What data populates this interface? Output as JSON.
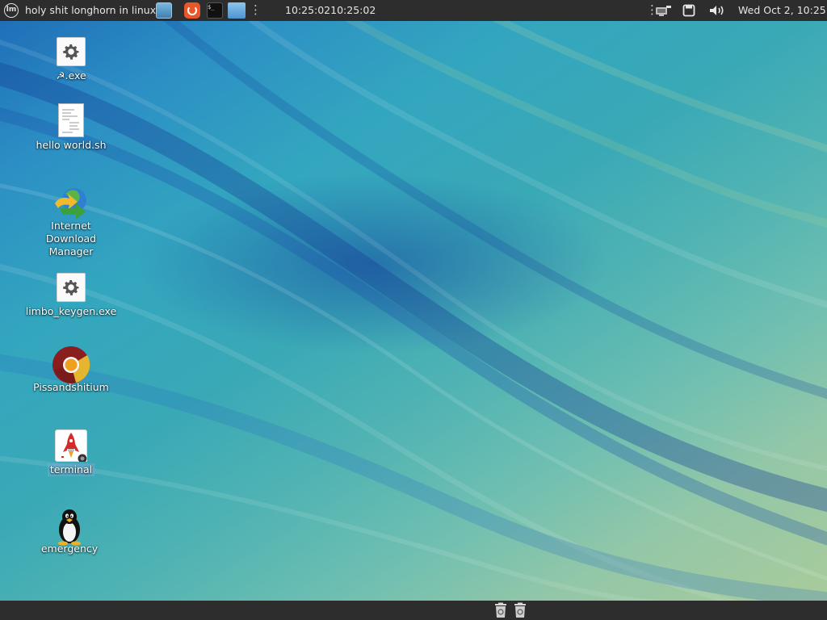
{
  "top_panel": {
    "menu_logo": "lm",
    "window_title": "holy shit longhorn in linux",
    "clock": "10:25:0210:25:02",
    "datetime": "Wed Oct  2, 10:25",
    "launchers": [
      "show-desktop-icon",
      "firefox-icon",
      "terminal-icon",
      "files-icon"
    ],
    "terminal_glyph": "$_",
    "tray": [
      "network-icon",
      "notifications-icon",
      "volume-icon"
    ]
  },
  "desktop": {
    "icons": [
      {
        "label": "☭.exe",
        "icon": "gear-icon"
      },
      {
        "label": "hello world.sh",
        "icon": "text-file-icon"
      },
      {
        "label": "Internet Download Manager",
        "icon": "idm-globe-icon"
      },
      {
        "label": "limbo_keygen.exe",
        "icon": "gear-icon"
      },
      {
        "label": "Pissandshitium",
        "icon": "chromium-icon"
      },
      {
        "label": "terminal",
        "icon": "rocket-icon",
        "selected": true
      },
      {
        "label": "emergency",
        "icon": "tux-penguin-icon"
      }
    ]
  },
  "bottom_panel": {
    "items": [
      "trash-icon",
      "trash-icon"
    ]
  },
  "colors": {
    "panel_bg": "#2d2d2d",
    "panel_text": "#e6e6e6",
    "wallpaper_deep_blue": "#1f6fb8",
    "wallpaper_teal": "#3aa9b6",
    "wallpaper_green": "#a9cb9b"
  }
}
